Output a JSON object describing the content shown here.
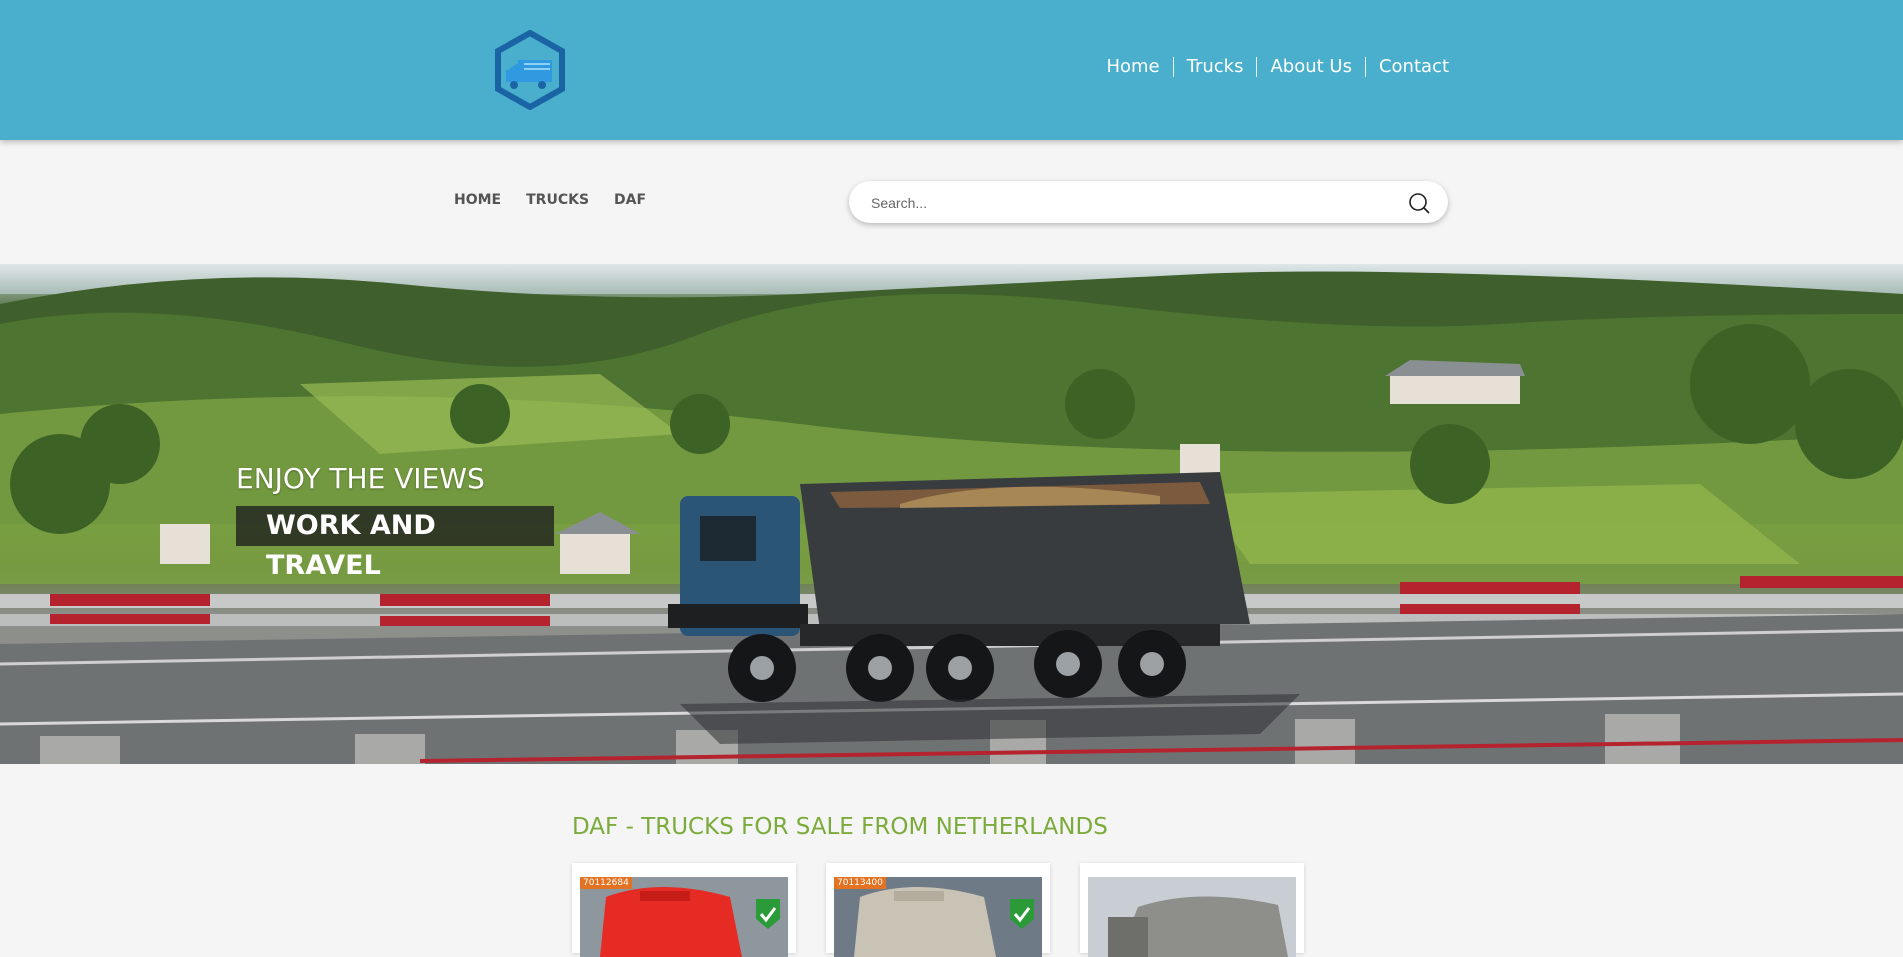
{
  "header": {
    "nav": [
      "Home",
      "Trucks",
      "About Us",
      "Contact"
    ]
  },
  "subnav": {
    "items": [
      "HOME",
      "TRUCKS",
      "DAF"
    ]
  },
  "search": {
    "placeholder": "Search..."
  },
  "hero": {
    "line1": "ENJOY THE VIEWS",
    "line2": "WORK AND TRAVEL"
  },
  "section": {
    "title": "DAF - TRUCKS FOR SALE FROM NETHERLANDS"
  },
  "cards": [
    {
      "id": "70112684"
    },
    {
      "id": "70113400"
    },
    {
      "id": ""
    }
  ],
  "colors": {
    "topbar": "#49afcc",
    "title_green": "#7bab3a",
    "tag_orange": "#e37222"
  }
}
